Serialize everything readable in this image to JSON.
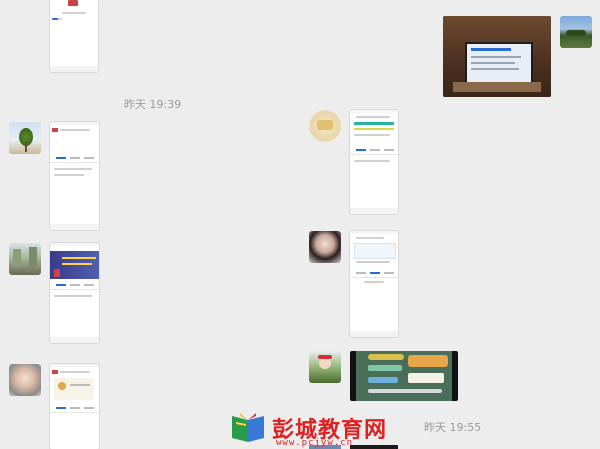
{
  "chat": {
    "timestamps": [
      "昨天 19:39",
      "昨天 19:55"
    ]
  },
  "watermark": {
    "brand": "彭城教育网",
    "url": "www.pcjyw.cn"
  },
  "colors": {
    "background": "#ededed",
    "timestamp": "#9a9a9a",
    "accent_blue": "#2a6bd1",
    "watermark_red": "#e02020"
  },
  "icons": [
    "palm-tree-avatar",
    "scenery-avatar",
    "street-avatar",
    "child-avatar",
    "girl-avatar",
    "outdoor-avatar",
    "lake-avatar"
  ]
}
